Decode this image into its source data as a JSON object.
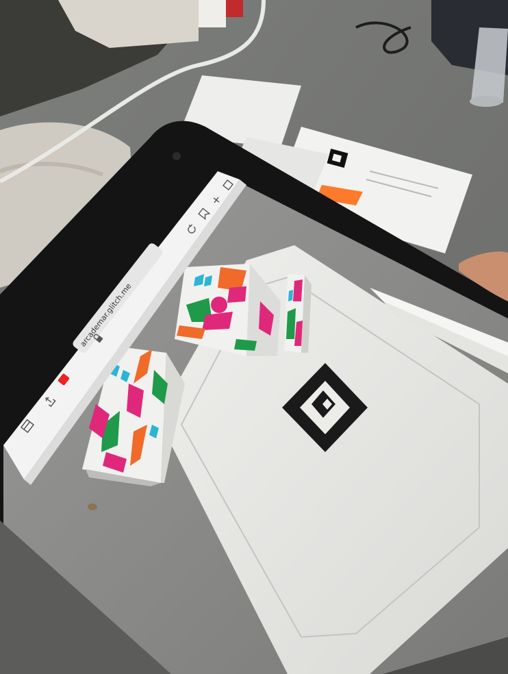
{
  "photo": {
    "browser": {
      "url": "arcademar.glitch.me"
    },
    "colors": {
      "desk": "#8a8a87",
      "tablet_frame": "#141414",
      "paper": "#e9e9e6",
      "marker": "#1a1a1a",
      "cube_green": "#1f9a4a",
      "cube_pink": "#e0287a",
      "cube_orange": "#f06a2a",
      "cube_cyan": "#2ab5d6",
      "sticky_note": "#ff7a2a"
    },
    "icons": [
      "lock-icon",
      "share-icon",
      "tabs-icon",
      "bookmark-icon",
      "reload-icon",
      "record-icon"
    ]
  }
}
